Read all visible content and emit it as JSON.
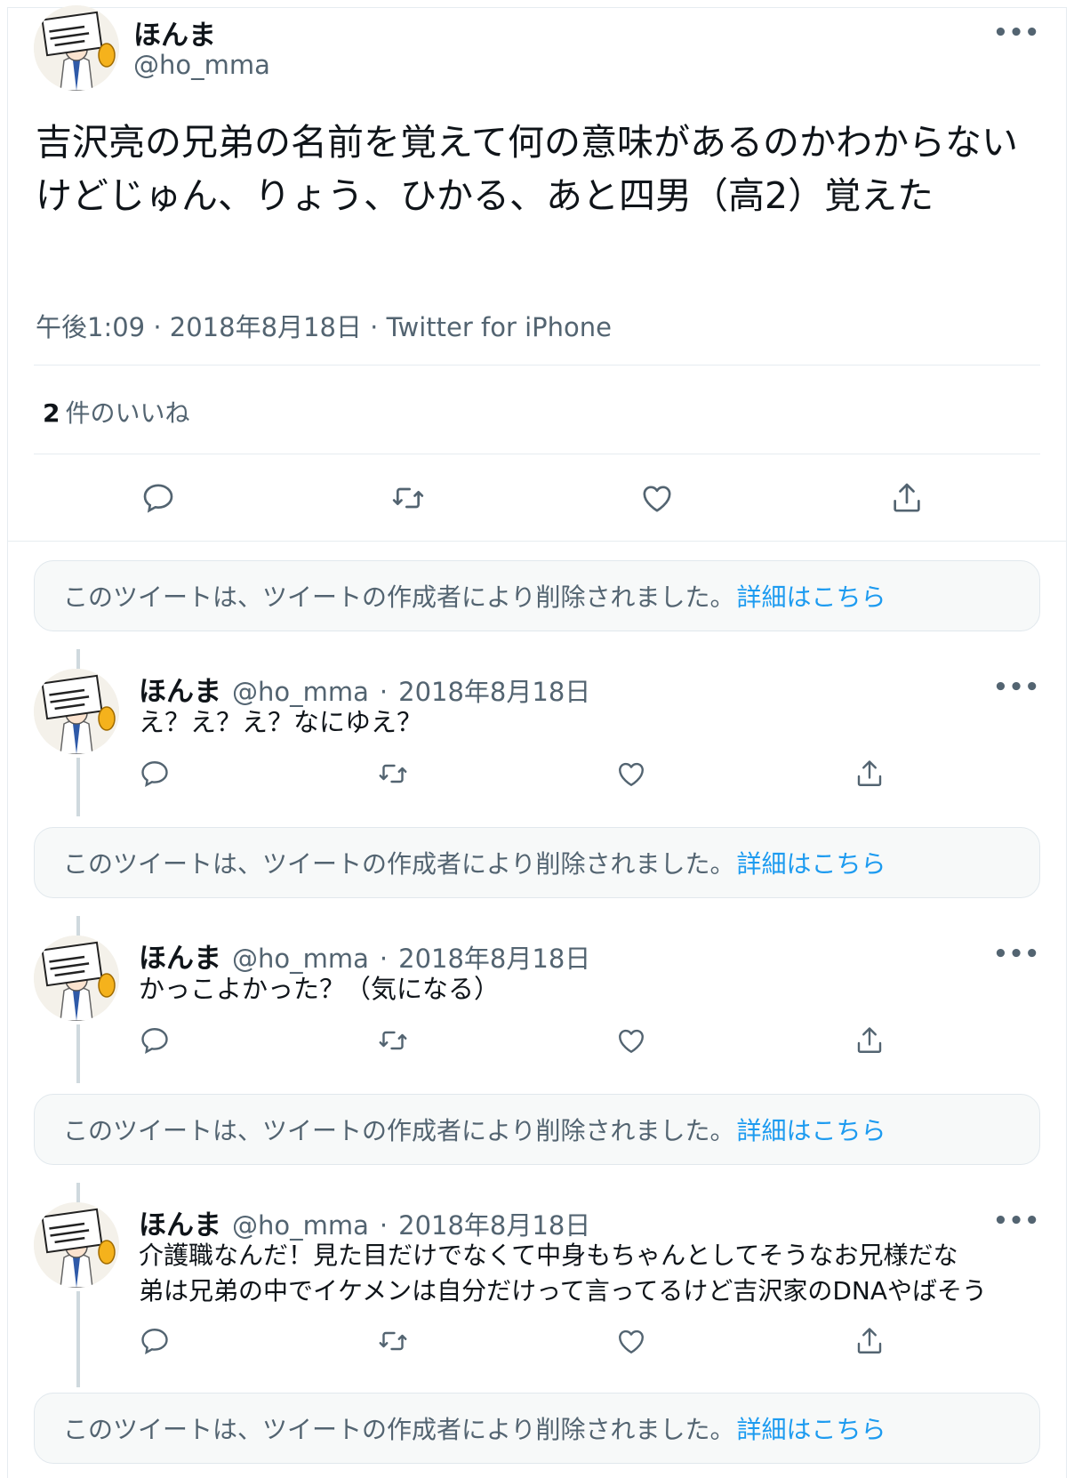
{
  "main_tweet": {
    "name": "ほんま",
    "handle": "@ho_mma",
    "text": "吉沢亮の兄弟の名前を覚えて何の意味があるのかわからないけどじゅん、りょう、ひかる、あと四男（高2）覚えた",
    "time": "午後1:09",
    "date": "2018年8月18日",
    "source": "Twitter for iPhone",
    "likes_count": "2",
    "likes_label": "件のいいね"
  },
  "deleted_notice": {
    "text": "このツイートは、ツイートの作成者により削除されました。",
    "link": "詳細はこちら"
  },
  "replies": [
    {
      "name": "ほんま",
      "handle": "@ho_mma",
      "date": "2018年8月18日",
      "lines": [
        "え？え？え？なにゆえ？"
      ]
    },
    {
      "name": "ほんま",
      "handle": "@ho_mma",
      "date": "2018年8月18日",
      "lines": [
        "かっこよかった？（気になる）"
      ]
    },
    {
      "name": "ほんま",
      "handle": "@ho_mma",
      "date": "2018年8月18日",
      "lines": [
        "介護職なんだ！見た目だけでなくて中身もちゃんとしてそうなお兄様だな",
        "弟は兄弟の中でイケメンは自分だけって言ってるけど吉沢家のDNAやばそう"
      ]
    }
  ],
  "separator": "·",
  "more_glyph": "•••",
  "avatar_sign_text": "我々にかまわず食事を続けてくれたまへ",
  "icons": [
    "reply-icon",
    "retweet-icon",
    "like-icon",
    "share-icon",
    "more-icon"
  ],
  "colors": {
    "link": "#1d9bf0",
    "secondary": "#536471",
    "border": "#e6ecf0",
    "text": "#0f1419"
  }
}
